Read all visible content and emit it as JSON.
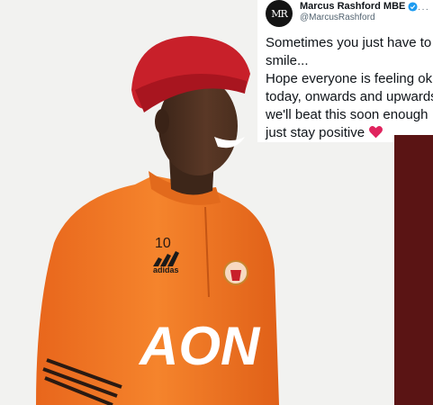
{
  "tweet": {
    "avatar_text": "MR",
    "display_name": "Marcus Rashford MBE",
    "handle": "@MarcusRashford",
    "more_icon": "ellipsis-icon",
    "lines": [
      "Sometimes you just have to",
      "smile...",
      "Hope everyone is feeling ok",
      "today, onwards and upwards,",
      "we'll beat this soon enough",
      "just stay positive"
    ]
  },
  "photo": {
    "shirt_number": "10",
    "kit_brand": "adidas",
    "sponsor": "AON"
  },
  "colors": {
    "verified_blue": "#1d9bf0",
    "heart_red": "#e0245e",
    "beanie_red": "#c8202a",
    "shirt_orange": "#f07a22"
  }
}
